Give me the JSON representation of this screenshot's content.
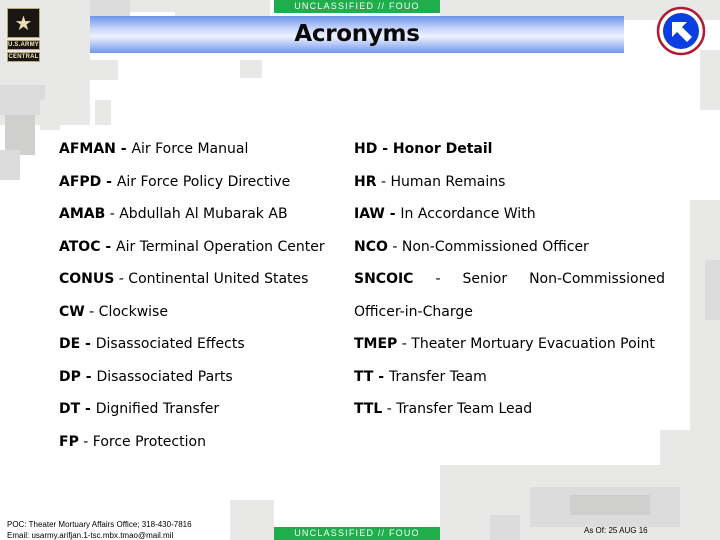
{
  "classification": {
    "top": "UNCLASSIFIED // FOUO",
    "bottom": "UNCLASSIFIED // FOUO",
    "color": "#1fae4b"
  },
  "header": {
    "title": "Acronyms",
    "logo": {
      "icon": "army-star-icon",
      "line1": "U.S.ARMY",
      "line2": "CENTRAL"
    },
    "return_icon": "return-arrow-icon"
  },
  "acronyms": {
    "left": [
      {
        "abbr": "AFMAN",
        "sep": " - ",
        "meaning": "Air Force Manual"
      },
      {
        "abbr": "AFPD",
        "sep": " - ",
        "meaning": "Air Force Policy Directive"
      },
      {
        "abbr": "AMAB",
        "sep": " - ",
        "meaning": "Abdullah Al Mubarak AB"
      },
      {
        "abbr": "ATOC",
        "sep": " - ",
        "meaning": "Air Terminal Operation Center"
      },
      {
        "abbr": "CONUS",
        "sep": " - ",
        "meaning": "Continental United States"
      },
      {
        "abbr": "CW",
        "sep": " - ",
        "meaning": "Clockwise"
      },
      {
        "abbr": "DE",
        "sep": " - ",
        "meaning": "Disassociated Effects"
      },
      {
        "abbr": "DP",
        "sep": " - ",
        "meaning": "Disassociated Parts"
      },
      {
        "abbr": "DT",
        "sep": " - ",
        "meaning": "Dignified Transfer"
      },
      {
        "abbr": "FP",
        "sep": " - ",
        "meaning": "Force Protection"
      }
    ],
    "right": [
      {
        "abbr": "HD",
        "sep": " - ",
        "meaning": "Honor Detail"
      },
      {
        "abbr": "HR",
        "sep": " - ",
        "meaning": "Human Remains"
      },
      {
        "abbr": "IAW",
        "sep": " - ",
        "meaning": "In Accordance With"
      },
      {
        "abbr": "NCO",
        "sep": " - ",
        "meaning": "Non-Commissioned Officer"
      },
      {
        "abbr": "SNCOIC",
        "sep": "-",
        "meaning_part1": "Senior",
        "meaning_part2": "Non-Commissioned",
        "meaning_cont": "Officer-in-Charge"
      },
      {
        "abbr": "TMEP",
        "sep": " - ",
        "meaning": "Theater Mortuary Evacuation Point"
      },
      {
        "abbr": "TT",
        "sep": " - ",
        "meaning": "Transfer Team"
      },
      {
        "abbr": "TTL",
        "sep": " - ",
        "meaning": "Transfer Team Lead"
      }
    ]
  },
  "footer": {
    "poc_line": "POC: Theater Mortuary Affairs Office; 318-430-7816",
    "email_line": "Email: usarmy.arifjan.1-tsc.mbx.tmao@mail.mil",
    "as_of": "As Of:  25 AUG 16"
  }
}
